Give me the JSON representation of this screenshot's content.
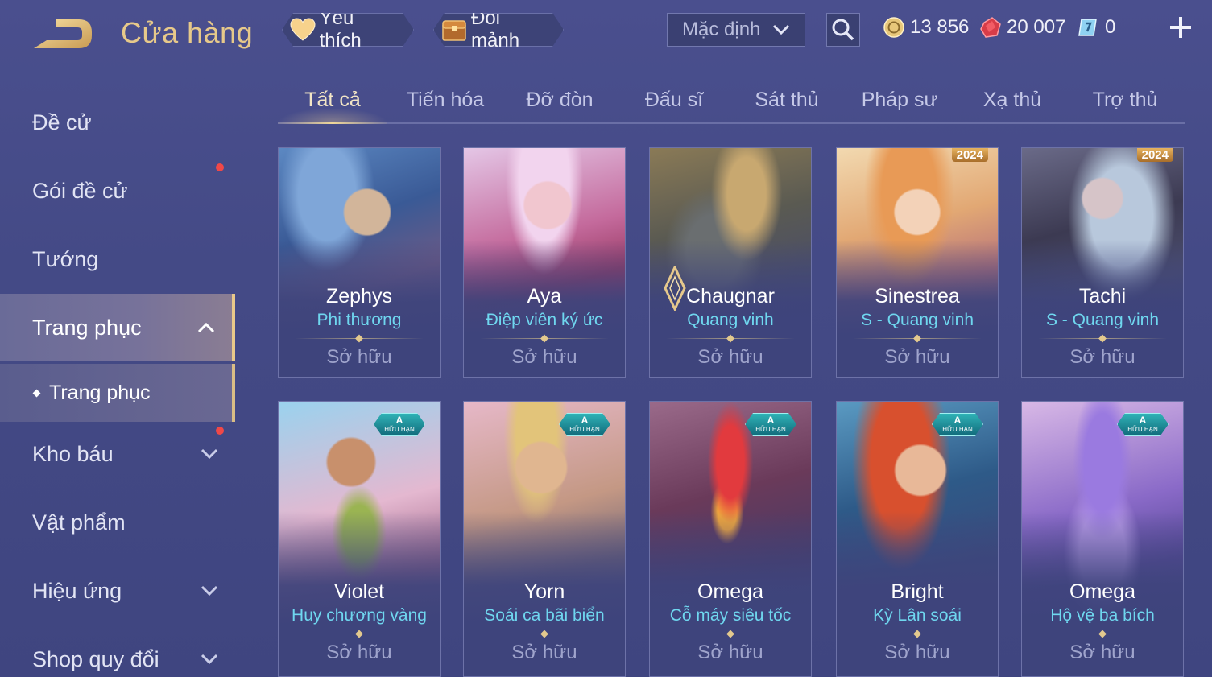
{
  "header": {
    "title": "Cửa hàng",
    "favorite_label": "Yêu thích",
    "shard_label": "Đổi mảnh",
    "sort_value": "Mặc định",
    "currencies": {
      "gold": "13 856",
      "ruby": "20 007",
      "voucher": "0"
    }
  },
  "sidebar": {
    "items": [
      {
        "label": "Đề cử"
      },
      {
        "label": "Gói đề cử"
      },
      {
        "label": "Tướng"
      },
      {
        "label": "Trang phục"
      },
      {
        "label": "Kho báu"
      },
      {
        "label": "Vật phẩm"
      },
      {
        "label": "Hiệu ứng"
      },
      {
        "label": "Shop quy đổi"
      }
    ],
    "sub_item": "Trang phục"
  },
  "tabs": [
    {
      "label": "Tất cả"
    },
    {
      "label": "Tiến hóa"
    },
    {
      "label": "Đỡ đòn"
    },
    {
      "label": "Đấu sĩ"
    },
    {
      "label": "Sát thủ"
    },
    {
      "label": "Pháp sư"
    },
    {
      "label": "Xạ thủ"
    },
    {
      "label": "Trợ thủ"
    }
  ],
  "cards": [
    {
      "hero": "Zephys",
      "skin": "Phi thương",
      "status": "Sở hữu"
    },
    {
      "hero": "Aya",
      "skin": "Điệp viên ký ức",
      "status": "Sở hữu"
    },
    {
      "hero": "Chaugnar",
      "skin": "Quang vinh",
      "status": "Sở hữu"
    },
    {
      "hero": "Sinestrea",
      "skin": "S - Quang vinh",
      "status": "Sở hữu",
      "badge": "2024"
    },
    {
      "hero": "Tachi",
      "skin": "S - Quang vinh",
      "status": "Sở hữu",
      "badge": "2024"
    },
    {
      "hero": "Violet",
      "skin": "Huy chương vàng",
      "status": "Sở hữu",
      "badge_letter": "A",
      "badge_sub": "HỮU HẠN"
    },
    {
      "hero": "Yorn",
      "skin": "Soái ca bãi biển",
      "status": "Sở hữu",
      "badge_letter": "A",
      "badge_sub": "HỮU HẠN"
    },
    {
      "hero": "Omega",
      "skin": "Cỗ máy siêu tốc",
      "status": "Sở hữu",
      "badge_letter": "A",
      "badge_sub": "HỮU HẠN"
    },
    {
      "hero": "Bright",
      "skin": "Kỳ Lân soái",
      "status": "Sở hữu",
      "badge_letter": "A",
      "badge_sub": "HỮU HẠN"
    },
    {
      "hero": "Omega",
      "skin": "Hộ vệ ba bích",
      "status": "Sở hữu",
      "badge_letter": "A",
      "badge_sub": "HỮU HẠN"
    }
  ],
  "colors": {
    "accent_gold": "#e7c98a",
    "skin_cyan": "#6fd7ef",
    "background": "#4a4f8e",
    "notification_red": "#f04848"
  }
}
